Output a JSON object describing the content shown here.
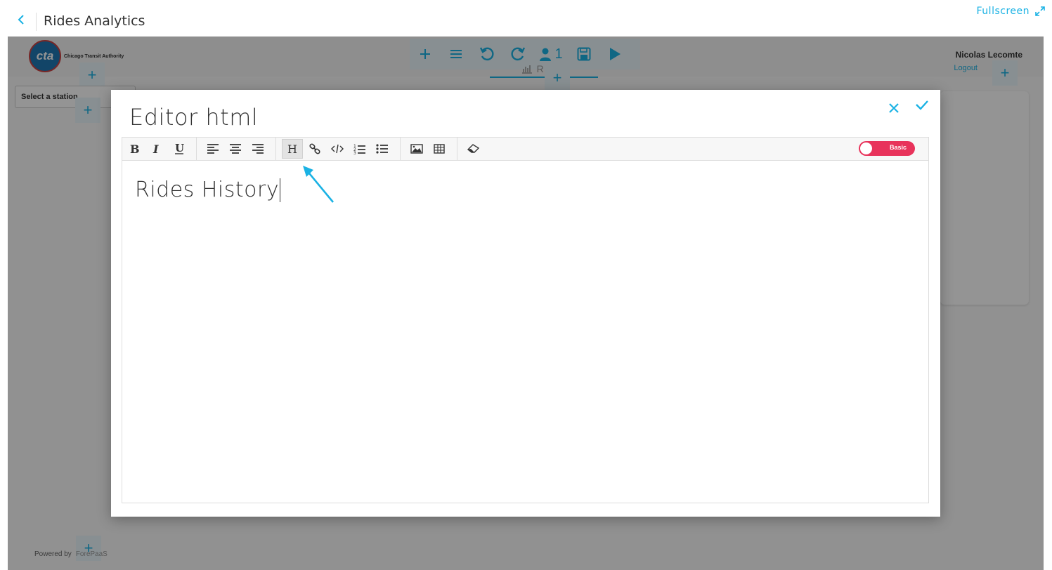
{
  "header": {
    "title": "Rides Analytics",
    "fullscreen_label": "Fullscreen"
  },
  "dashboard": {
    "logo_abbrev": "cta",
    "logo_text": "Chicago Transit Authority",
    "toolbar": {
      "buttons": [
        "add-icon",
        "menu-icon",
        "undo-icon",
        "redo-icon",
        "user-icon",
        "save-icon",
        "play-icon"
      ],
      "user_count": "1"
    },
    "tab_label": "RIDES",
    "user_name": "Nicolas Lecomte",
    "logout_label": "Logout",
    "station_placeholder": "Select a station...",
    "powered_by": "Powered by",
    "powered_brand": "ForePaaS"
  },
  "modal": {
    "title": "Editor html",
    "toolbar_buttons": [
      "bold",
      "italic",
      "underline",
      "align-left",
      "align-center",
      "align-right",
      "heading",
      "link",
      "code",
      "ordered-list",
      "unordered-list",
      "image",
      "table",
      "eraser"
    ],
    "mode_toggle_label": "Basic",
    "content_heading": "Rides History"
  },
  "colors": {
    "accent": "#1ab2e4",
    "toggle": "#e8335b",
    "overlay": "rgba(0,0,0,0.42)"
  }
}
